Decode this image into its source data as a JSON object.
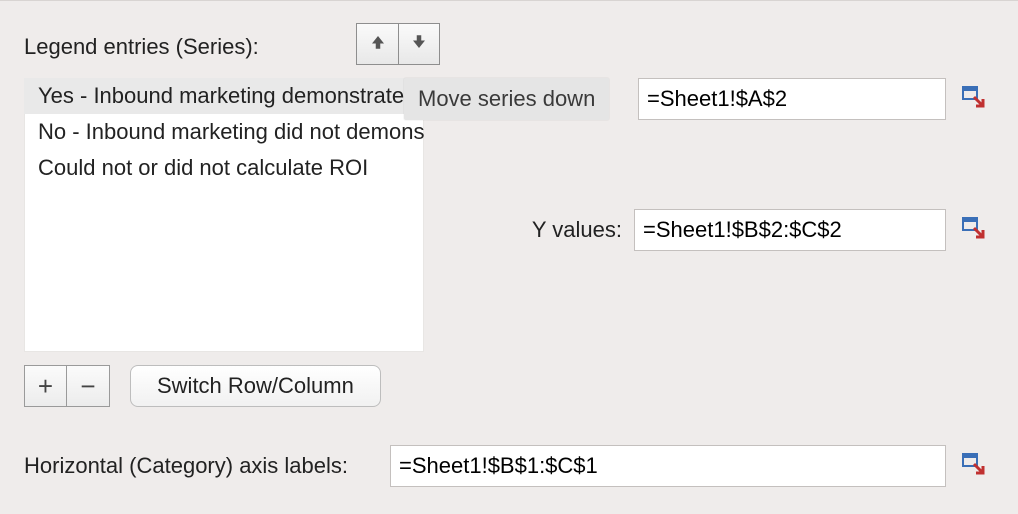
{
  "labels": {
    "legend_entries": "Legend entries (Series):",
    "y_values": "Y values:",
    "horizontal_axis": "Horizontal (Category) axis labels:",
    "switch_row_col": "Switch Row/Column",
    "move_series_down_tooltip": "Move series down"
  },
  "series_list": {
    "selected_index": 0,
    "items": [
      "Yes - Inbound marketing demonstrated ROI",
      "No - Inbound marketing did not demonstrate ROI",
      "Could not or did not calculate ROI"
    ]
  },
  "fields": {
    "name_ref": "=Sheet1!$A$2",
    "y_values_ref": "=Sheet1!$B$2:$C$2",
    "axis_labels_ref": "=Sheet1!$B$1:$C$1"
  },
  "icons": {
    "up": "arrow-up-icon",
    "down": "arrow-down-icon",
    "plus": "+",
    "minus": "−",
    "picker": "range-picker-icon"
  }
}
